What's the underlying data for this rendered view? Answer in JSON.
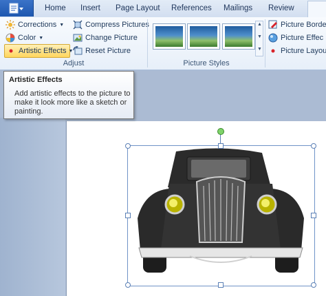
{
  "file_button": {
    "icon": "word-app-icon"
  },
  "tabs": [
    "Home",
    "Insert",
    "Page Layout",
    "References",
    "Mailings",
    "Review"
  ],
  "adjust_group": {
    "label": "Adjust",
    "corrections": "Corrections",
    "color": "Color",
    "artistic_effects": "Artistic Effects",
    "compress_pictures": "Compress Pictures",
    "change_picture": "Change Picture",
    "reset_picture": "Reset Picture"
  },
  "picture_styles_group": {
    "label": "Picture Styles",
    "picture_border": "Picture Borde",
    "picture_effects": "Picture Effec",
    "picture_layout": "Picture Layou"
  },
  "tooltip": {
    "title": "Artistic Effects",
    "body": "Add artistic effects to the picture to make it look more like a sketch or painting."
  },
  "colors": {
    "ribbon_top": "#f8fbfe",
    "ribbon_bottom": "#e7eff9",
    "file_button": "#2a62bc",
    "doc_background": "#abbbd3",
    "selection": "#6f93c7",
    "rotate_handle": "#7fd36a"
  }
}
